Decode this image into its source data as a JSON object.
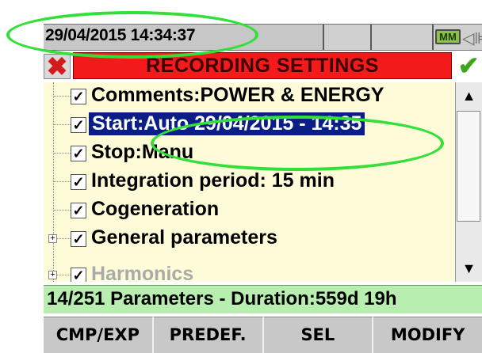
{
  "status_bar": {
    "datetime": "29/04/2015 14:34:37",
    "battery_label": "ΜΜ",
    "power_icon": "plug-icon"
  },
  "header": {
    "title": "RECORDING SETTINGS",
    "cancel_icon": "close-icon",
    "confirm_icon": "checkmark-icon"
  },
  "tree": {
    "items": [
      {
        "label": "Comments:POWER & ENERGY",
        "checked": true,
        "selected": false
      },
      {
        "label": "Start:Auto 29/04/2015 - 14:35",
        "checked": true,
        "selected": true
      },
      {
        "label": "Stop:Manu",
        "checked": true,
        "selected": false
      },
      {
        "label": "Integration period: 15 min",
        "checked": true,
        "selected": false
      },
      {
        "label": "Cogeneration",
        "checked": true,
        "selected": false
      },
      {
        "label": "General parameters",
        "checked": true,
        "selected": false,
        "expandable": true
      },
      {
        "label": "Harmonics",
        "checked": true,
        "selected": false,
        "partially_visible": true
      }
    ]
  },
  "info_bar": {
    "text": "14/251 Parameters - Duration:559d 19h"
  },
  "softkeys": {
    "k1": "CMP/EXP",
    "k2": "PREDEF.",
    "k3": "SEL",
    "k4": "MODIFY"
  },
  "colors": {
    "title_bg": "#f21a1a",
    "selection_bg": "#0a1e86",
    "info_bg": "#b8eeb0",
    "highlight_oval": "#33e03a"
  }
}
